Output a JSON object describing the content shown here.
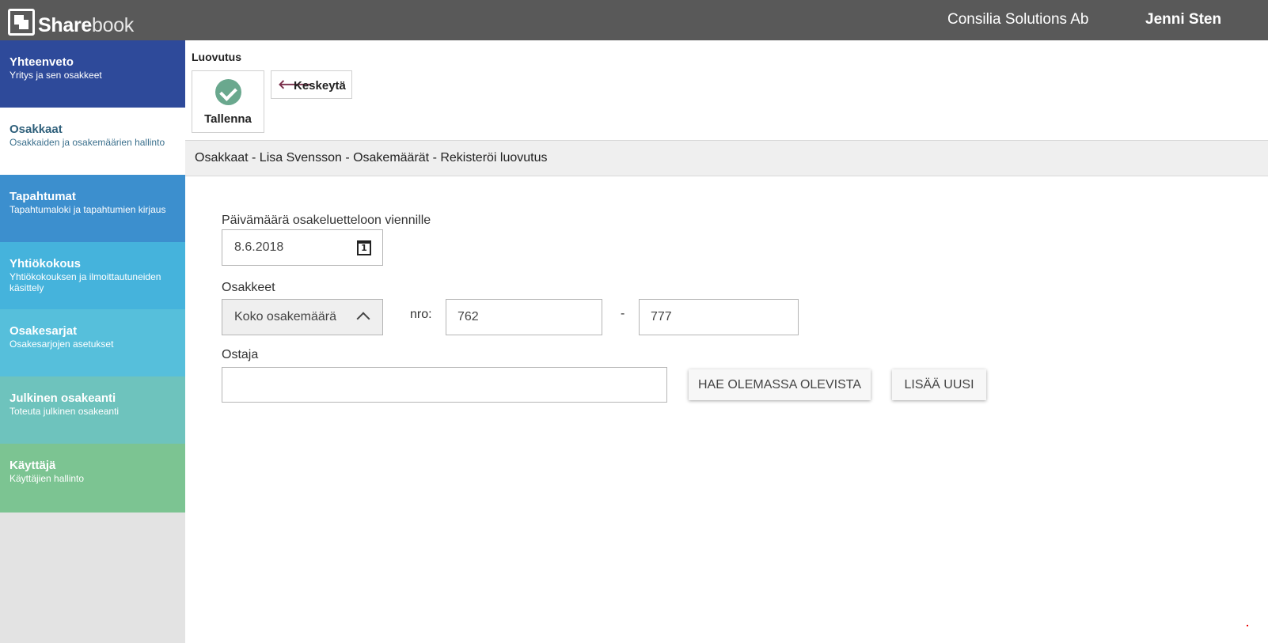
{
  "header": {
    "logo_strong": "Share",
    "logo_light": "book",
    "company": "Consilia Solutions Ab",
    "user": "Jenni Sten"
  },
  "sidebar": {
    "items": [
      {
        "title": "Yhteenveto",
        "subtitle": "Yritys ja sen osakkeet",
        "color": "#2e4a9a",
        "active": false
      },
      {
        "title": "Osakkaat",
        "subtitle": "Osakkaiden ja osakemäärien hallinto",
        "color": "#ffffff",
        "active": true
      },
      {
        "title": "Tapahtumat",
        "subtitle": "Tapahtumaloki ja tapahtumien kirjaus",
        "color": "#3c8fce",
        "active": false
      },
      {
        "title": "Yhtiökokous",
        "subtitle": "Yhtiökokouksen ja ilmoittautuneiden käsittely",
        "color": "#45b3dc",
        "active": false
      },
      {
        "title": "Osakesarjat",
        "subtitle": "Osakesarjojen asetukset",
        "color": "#56bfdb",
        "active": false
      },
      {
        "title": "Julkinen osakeanti",
        "subtitle": "Toteuta julkinen osakeanti",
        "color": "#6ec3bd",
        "active": false
      },
      {
        "title": "Käyttäjä",
        "subtitle": "Käyttäjien hallinto",
        "color": "#7cc492",
        "active": false
      }
    ]
  },
  "toolbar": {
    "section_label": "Luovutus",
    "save_label": "Tallenna",
    "cancel_label": "Keskeytä",
    "cancel_arrow": "🡐"
  },
  "breadcrumb": "Osakkaat - Lisa Svensson - Osakemäärät - Rekisteröi luovutus",
  "form": {
    "date_label": "Päivämäärä osakeluetteloon viennille",
    "date_value": "8.6.2018",
    "calendar_day": "1",
    "shares_label": "Osakkeet",
    "shares_select_value": "Koko osakemäärä",
    "nro_label": "nro:",
    "nro_from": "762",
    "range_dash": "-",
    "nro_to": "777",
    "buyer_label": "Ostaja",
    "buyer_value": "",
    "search_existing_label": "HAE OLEMASSA OLEVISTA",
    "add_new_label": "LISÄÄ UUSI"
  },
  "colors": {
    "topbar": "#595959",
    "accent_check": "#6aa88e",
    "cancel_arrow": "#7a2e4a"
  }
}
